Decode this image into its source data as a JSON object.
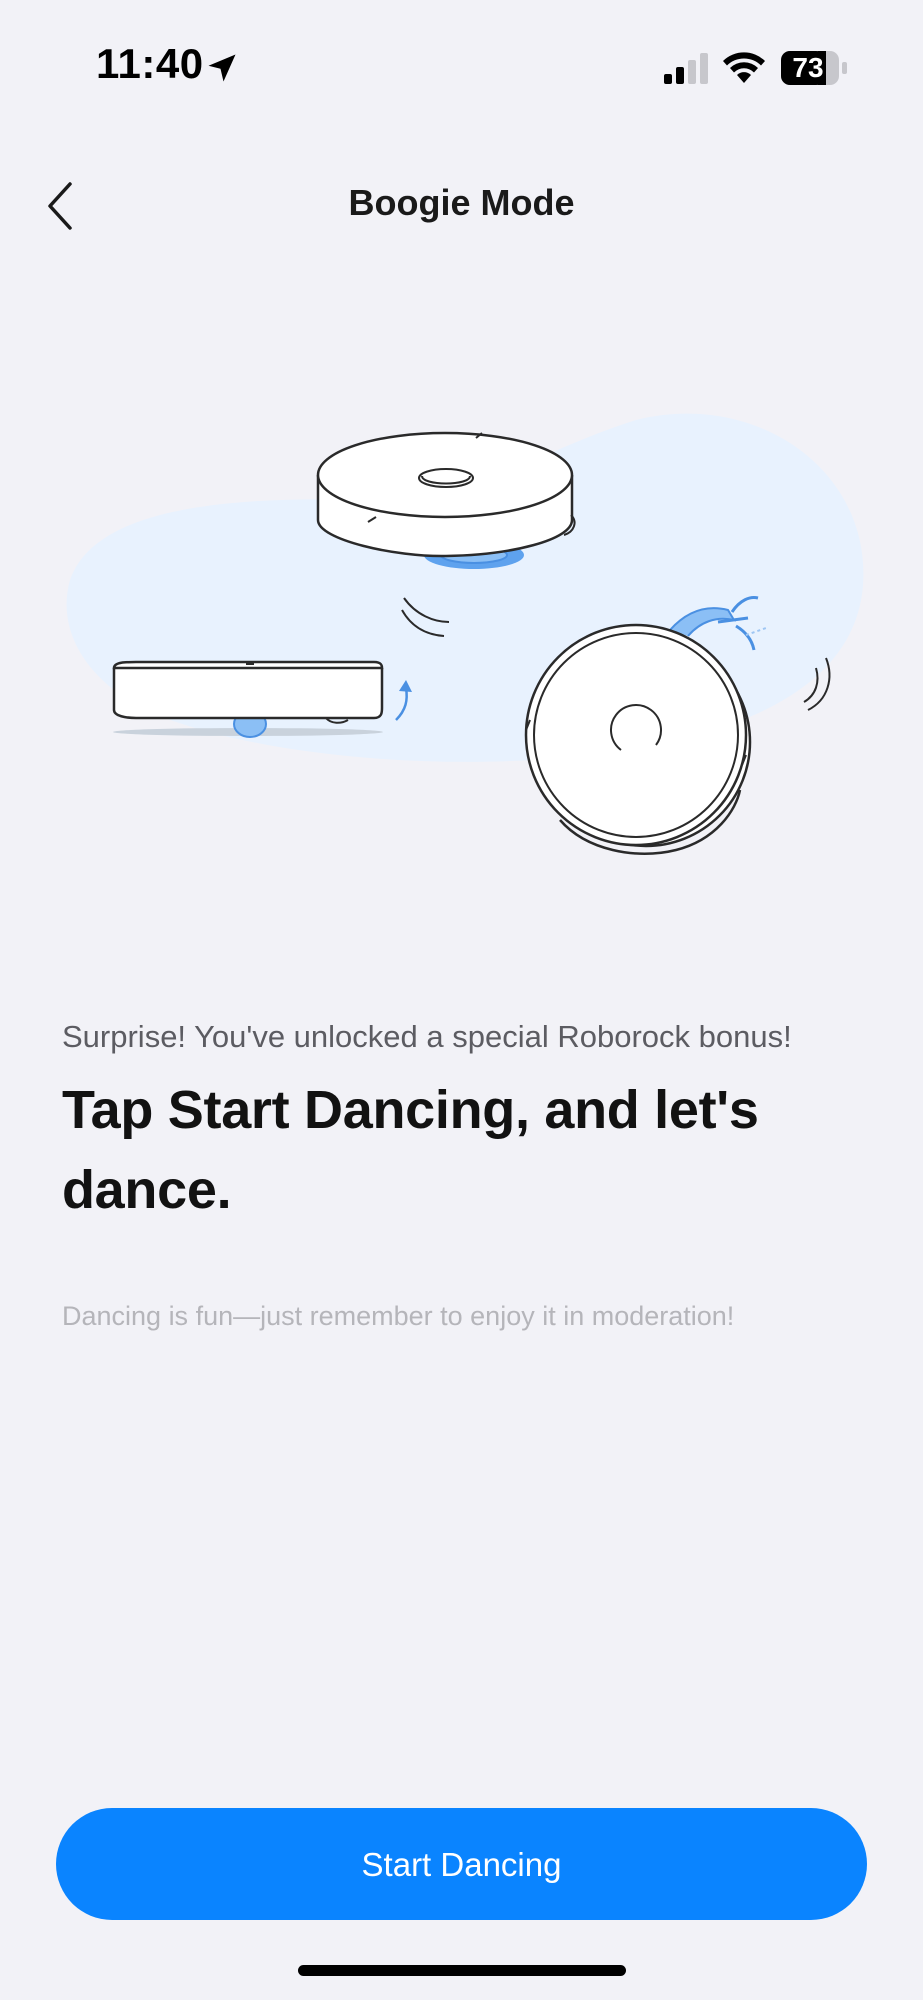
{
  "status_bar": {
    "time": "11:40",
    "battery": "73",
    "icons": [
      "location-arrow-icon",
      "signal-icon",
      "wifi-icon",
      "battery-icon"
    ]
  },
  "nav": {
    "title": "Boogie Mode",
    "back_icon": "chevron-left-icon"
  },
  "illustration": {
    "subject": "robot-vacuums-dancing",
    "accent_color": "#4a90e2",
    "blob_color": "#e8f2fe"
  },
  "content": {
    "subtitle": "Surprise! You've unlocked a special Roborock bonus!",
    "headline": "Tap Start Dancing, and let's dance.",
    "note": "Dancing is fun—just remember to enjoy it in moderation!"
  },
  "actions": {
    "start_label": "Start Dancing"
  },
  "colors": {
    "background": "#f2f2f7",
    "primary": "#0a84ff",
    "text_primary": "#121212",
    "text_secondary": "#5c5c62",
    "text_muted": "#b5b5ba"
  }
}
